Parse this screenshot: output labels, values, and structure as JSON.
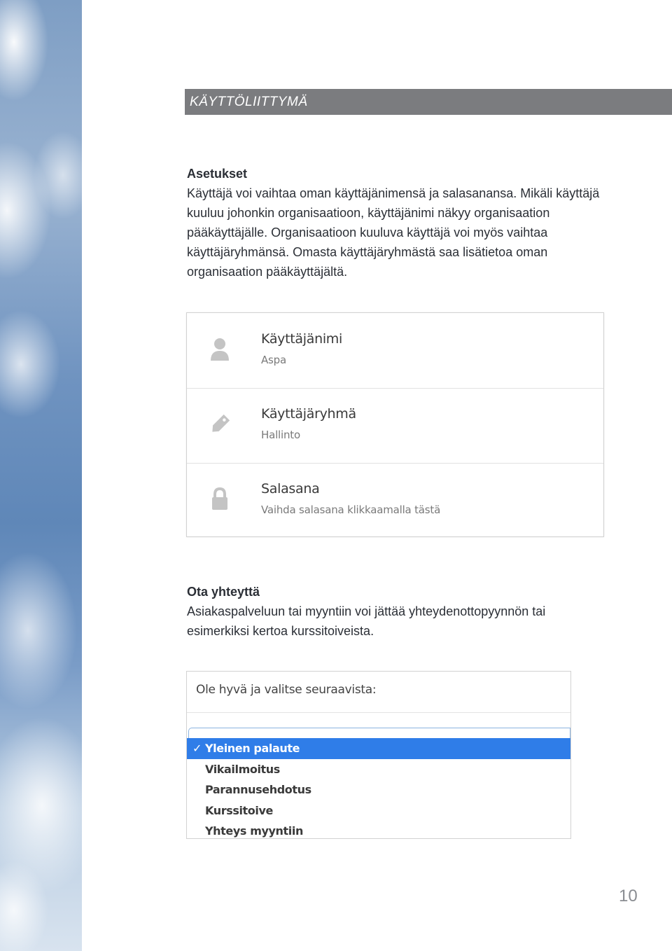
{
  "header": {
    "title": "KÄYTTÖLIITTYMÄ"
  },
  "settings_section": {
    "heading": "Asetukset",
    "body": "Käyttäjä voi vaihtaa oman käyttäjänimensä ja salasanansa. Mikäli käyttäjä kuuluu johonkin organisaatioon, käyttäjänimi näkyy organisaation pääkäyttäjälle. Organisaatioon kuuluva käyttäjä voi myös vaihtaa käyttäjäryhmänsä. Omasta käyttäjäryhmästä saa lisätietoa oman organisaation pääkäyttäjältä."
  },
  "settings_card": {
    "rows": [
      {
        "icon": "user-icon",
        "label": "Käyttäjänimi",
        "value": "Aspa"
      },
      {
        "icon": "tag-icon",
        "label": "Käyttäjäryhmä",
        "value": "Hallinto"
      },
      {
        "icon": "lock-icon",
        "label": "Salasana",
        "value": "Vaihda salasana klikkaamalla tästä"
      }
    ]
  },
  "contact_section": {
    "heading": "Ota yhteyttä",
    "body": "Asiakaspalveluun tai myyntiin voi jättää yhteydenottopyynnön tai esimerkiksi kertoa kurssitoiveista."
  },
  "select_card": {
    "prompt": "Ole hyvä ja valitse seuraavista:",
    "check_glyph": "✓",
    "options": [
      "Yleinen palaute",
      "Vikailmoitus",
      "Parannusehdotus",
      "Kurssitoive",
      "Yhteys myyntiin"
    ],
    "selected_index": 0
  },
  "page_number": "10",
  "colors": {
    "header_bar": "#7b7c7f",
    "selected_option": "#2f7de8",
    "icon_gray": "#c4c4c4"
  }
}
